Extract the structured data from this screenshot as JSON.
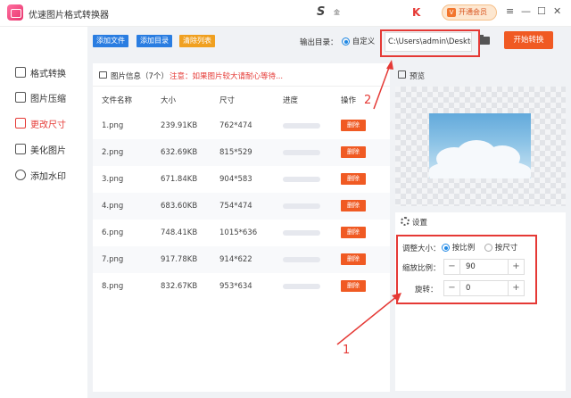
{
  "app": {
    "title": "优速图片格式转换器",
    "user_logo": "S",
    "user_text": "金",
    "vip_label": "开通会员",
    "vip_icon": "V",
    "flag_icon": "K"
  },
  "window_controls": [
    "≡",
    "—",
    "☐",
    "✕"
  ],
  "sidebar": {
    "items": [
      {
        "label": "格式转换"
      },
      {
        "label": "图片压缩"
      },
      {
        "label": "更改尺寸",
        "active": true
      },
      {
        "label": "美化图片"
      },
      {
        "label": "添加水印"
      }
    ]
  },
  "toolbar": {
    "add_file": "添加文件",
    "add_dir": "添加目录",
    "clear_list": "清除列表"
  },
  "output": {
    "label": "输出目录：",
    "radio_label": "自定义",
    "path": "C:\\Users\\admin\\Deskto",
    "start_button": "开始转换"
  },
  "file_panel": {
    "title": "图片信息（7个）",
    "note": "注意：如果图片较大请耐心等待...",
    "columns": [
      "文件名称",
      "大小",
      "尺寸",
      "进度",
      "操作"
    ],
    "rows": [
      {
        "name": "1.png",
        "size": "239.91KB",
        "dims": "762*474",
        "progress": 0,
        "action": "删除"
      },
      {
        "name": "2.png",
        "size": "632.69KB",
        "dims": "815*529",
        "progress": 0,
        "action": "删除"
      },
      {
        "name": "3.png",
        "size": "671.84KB",
        "dims": "904*583",
        "progress": 0,
        "action": "删除"
      },
      {
        "name": "4.png",
        "size": "683.60KB",
        "dims": "754*474",
        "progress": 0,
        "action": "删除"
      },
      {
        "name": "6.png",
        "size": "748.41KB",
        "dims": "1015*636",
        "progress": 0,
        "action": "删除"
      },
      {
        "name": "7.png",
        "size": "917.78KB",
        "dims": "914*622",
        "progress": 0,
        "action": "删除"
      },
      {
        "name": "8.png",
        "size": "832.67KB",
        "dims": "953*634",
        "progress": 0,
        "action": "删除"
      }
    ]
  },
  "preview": {
    "title": "预览"
  },
  "settings": {
    "title": "设置",
    "resize_label": "调整大小：",
    "opt_ratio": "按比例",
    "opt_size": "按尺寸",
    "scale_label": "缩放比例：",
    "scale_value": "90",
    "rotate_label": "旋转：",
    "rotate_value": "0",
    "minus": "−",
    "plus": "+"
  },
  "annotations": {
    "one": "1",
    "two": "2"
  },
  "colors": {
    "accent": "#f05a23",
    "blue": "#2a7de1",
    "active_red": "#e53935"
  }
}
